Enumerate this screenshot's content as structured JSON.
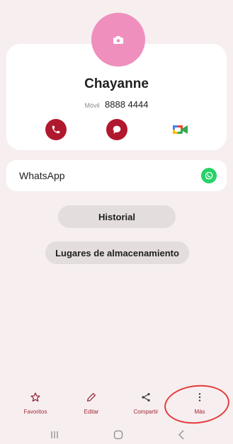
{
  "contact": {
    "name": "Chayanne",
    "phone_type": "Móvil",
    "phone_number": "8888 4444"
  },
  "apps": {
    "whatsapp_label": "WhatsApp"
  },
  "buttons": {
    "history": "Historial",
    "storage": "Lugares de almacenamiento"
  },
  "bottom_bar": {
    "favorites": "Favoritos",
    "edit": "Editar",
    "share": "Compartir",
    "more": "Más"
  },
  "icons": {
    "avatar": "camera-icon",
    "call": "phone-icon",
    "message": "message-icon",
    "video": "video-call-icon",
    "whatsapp": "whatsapp-icon",
    "favorites": "star-icon",
    "edit": "pencil-icon",
    "share": "share-icon",
    "more": "more-vertical-icon",
    "recent": "recent-apps-icon",
    "home": "home-icon",
    "back": "back-icon"
  },
  "colors": {
    "background": "#f7efef",
    "card": "#ffffff",
    "accent": "#b0182e",
    "avatar": "#ef8fbd",
    "whatsapp": "#25d366",
    "pill": "#e3dddd",
    "annotation": "#e43a3a"
  }
}
